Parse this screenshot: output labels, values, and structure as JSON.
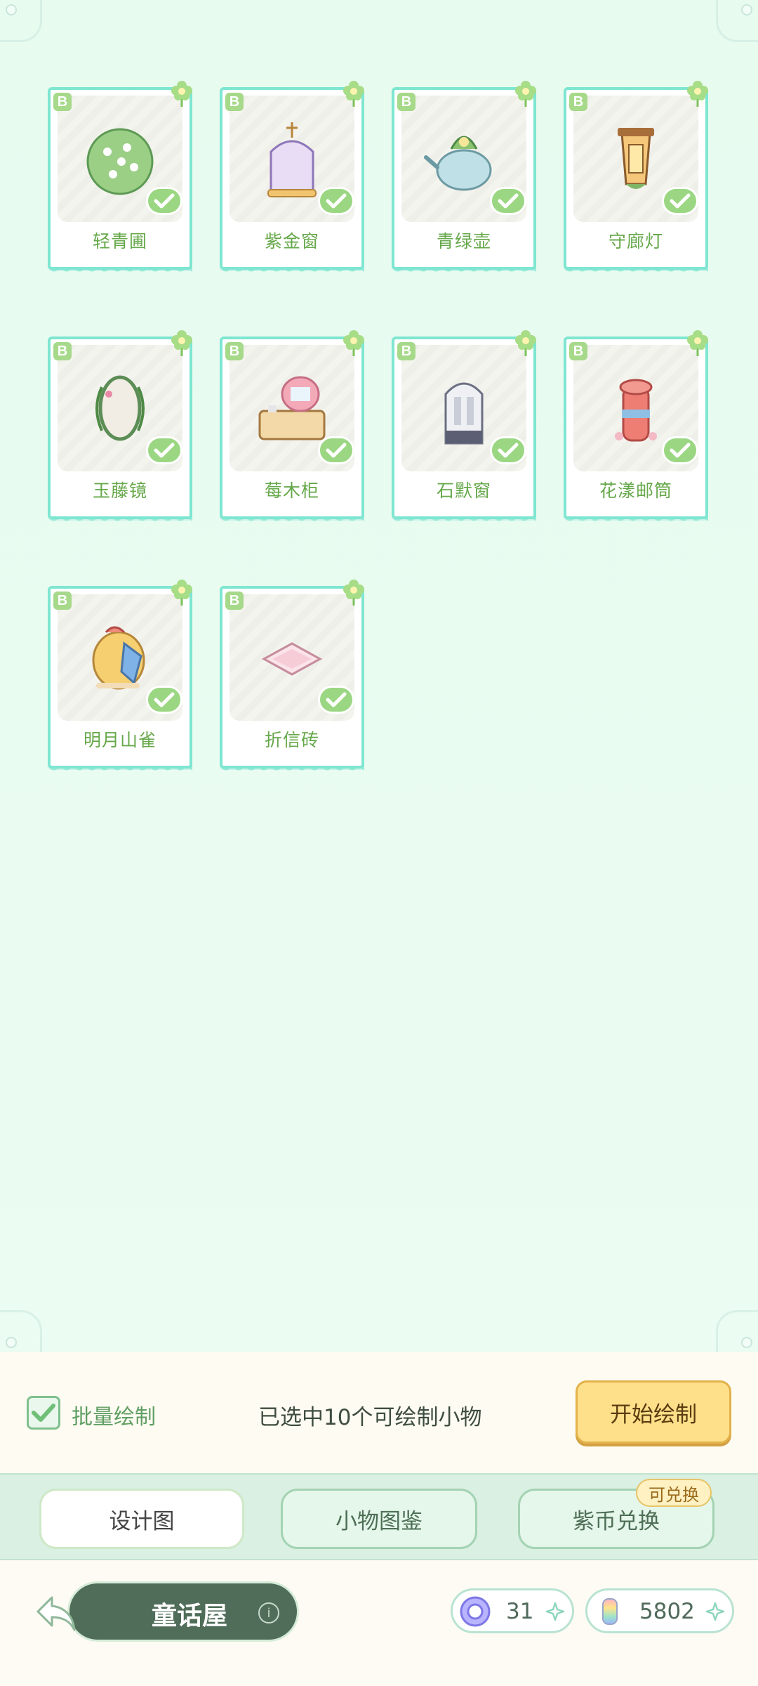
{
  "items": [
    {
      "name": "轻青圃",
      "rarity": "B",
      "art": "shrub-icon"
    },
    {
      "name": "紫金窗",
      "rarity": "B",
      "art": "gazebo-icon"
    },
    {
      "name": "青绿壶",
      "rarity": "B",
      "art": "teapot-icon"
    },
    {
      "name": "守廊灯",
      "rarity": "B",
      "art": "lantern-icon"
    },
    {
      "name": "玉藤镜",
      "rarity": "B",
      "art": "mirror-icon"
    },
    {
      "name": "莓木柜",
      "rarity": "B",
      "art": "cabinet-icon"
    },
    {
      "name": "石默窗",
      "rarity": "B",
      "art": "stone-window-icon"
    },
    {
      "name": "花漾邮筒",
      "rarity": "B",
      "art": "mailbox-icon"
    },
    {
      "name": "明月山雀",
      "rarity": "B",
      "art": "bird-icon"
    },
    {
      "name": "折信砖",
      "rarity": "B",
      "art": "tile-icon"
    }
  ],
  "batch": {
    "label": "批量绘制",
    "selected_text": "已选中10个可绘制小物",
    "start_button": "开始绘制"
  },
  "tabs": {
    "design": "设计图",
    "catalog": "小物图鉴",
    "exchange": "紫币兑换",
    "exchange_badge": "可兑换"
  },
  "footer": {
    "title": "童话屋",
    "info": "i",
    "currency_purple": "31",
    "currency_feather": "5802"
  },
  "colors": {
    "card_border": "#7ee6d1",
    "check": "#9bd782",
    "start_button": "#ffe08a",
    "home_pill": "#4f6d58"
  }
}
